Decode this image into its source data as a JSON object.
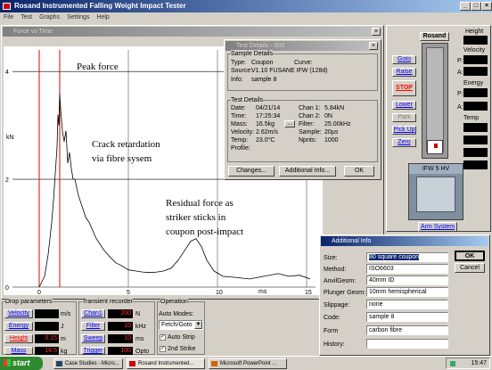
{
  "app": {
    "title": "Rosand Instrumented Falling Weight Impact Tester",
    "menus": [
      "File",
      "Test",
      "Graphs",
      "Settings",
      "Help"
    ]
  },
  "plot_window": {
    "title": "Force vs Time",
    "y_unit": "kN",
    "x_unit": "ms",
    "y_ticks": [
      "4",
      "2",
      "0"
    ],
    "x_ticks": [
      "0",
      "5",
      "10",
      "15"
    ],
    "annotations": {
      "peak": "Peak force",
      "crack_line1": "Crack retardation",
      "crack_line2": "via fibre sysem",
      "resid_line1": "Residual force as",
      "resid_line2": "striker sticks in",
      "resid_line3": "coupon post-impact"
    }
  },
  "chart_data": {
    "type": "line",
    "xlabel": "ms",
    "ylabel": "kN",
    "ylim": [
      0,
      4.4
    ],
    "xlim": [
      -1.5,
      15.5
    ],
    "x": [
      0,
      0.3,
      0.5,
      0.7,
      0.8,
      0.9,
      1.0,
      1.05,
      1.1,
      1.15,
      1.2,
      1.25,
      1.3,
      1.4,
      1.5,
      1.6,
      1.7,
      1.8,
      1.9,
      2.0,
      2.2,
      2.4,
      2.6,
      2.8,
      3.0,
      3.2,
      3.4,
      3.6,
      3.8,
      4.0,
      4.3,
      4.6,
      5.0,
      5.4,
      5.8,
      6.2,
      6.6,
      7.0,
      7.4,
      7.8,
      8.2,
      8.5,
      8.8,
      9.1,
      9.4,
      9.8,
      10.3,
      11.0,
      11.8,
      12.6,
      13.4,
      14.0,
      14.6,
      15.2
    ],
    "y": [
      0,
      0.2,
      0.6,
      1.2,
      1.6,
      2.1,
      2.6,
      3.2,
      3.0,
      3.6,
      3.3,
      3.1,
      2.9,
      2.7,
      2.9,
      2.3,
      2.5,
      2.2,
      2.0,
      2.0,
      1.7,
      1.5,
      1.3,
      1.2,
      1.05,
      0.9,
      0.8,
      0.7,
      0.62,
      0.55,
      0.45,
      0.4,
      0.32,
      0.3,
      0.28,
      0.27,
      0.28,
      0.3,
      0.35,
      0.5,
      0.7,
      0.85,
      0.9,
      0.75,
      0.5,
      0.3,
      0.2,
      0.18,
      0.15,
      0.2,
      0.25,
      0.2,
      0.22,
      0.15
    ]
  },
  "test_details": {
    "title": "Test Details - 003",
    "sample_header": "Sample Details",
    "type_label": "Type:",
    "type_value": "Coupon",
    "curve_label": "Curve:",
    "source_label": "Source:",
    "source_value": "V1.10 FUSANE IFW (128d)",
    "info_label": "Info:",
    "info_value": "sample 8",
    "test_header": "Test Details",
    "date_label": "Date:",
    "date_value": "04/21/14",
    "time_label": "Time:",
    "time_value": "17:25:34",
    "mass_label": "Mass:",
    "mass_value": "16.5kg",
    "velocity_label": "Velocity:",
    "velocity_value": "2.62m/s",
    "temp_label": "Temp:",
    "temp_value": "23.0°C",
    "profile_label": "Profile:",
    "chan1_label": "Chan 1:",
    "chan1_value": "5.84kN",
    "chan2_label": "Chan 2:",
    "chan2_value": "0N",
    "filter_label": "Filter:",
    "filter_value": "25.00kHz",
    "sample_label": "Sample:",
    "sample_value": "20µs",
    "npnts_label": "Npnts:",
    "npnts_value": "1000",
    "ellipsis": "...",
    "btn_changes": "Changes...",
    "btn_additional": "Additional Info...",
    "btn_ok": "OK"
  },
  "additional_info": {
    "title": "Additional Info",
    "size_label": "Size:",
    "size_value": "80 square coupon",
    "method_label": "Method:",
    "method_value": "ISO6603",
    "anvil_label": "AnvilGeom:",
    "anvil_value": "40mm ID",
    "plunger_label": "Plunger Geom:",
    "plunger_value": "10mm hemispherical",
    "slippage_label": "Slippage:",
    "slippage_value": "none",
    "code_label": "Code:",
    "code_value": "sample 8",
    "form_label": "Form",
    "form_value": "carbon fibre",
    "history_label": "History:",
    "history_value": "",
    "btn_ok": "OK",
    "btn_cancel": "Cancel"
  },
  "control": {
    "rosand": "Rosand",
    "goto": "Goto",
    "raise": "Raise",
    "stop": "STOP",
    "lower": "Lower",
    "park": "Park",
    "pick_up": "Pick Up",
    "zero": "Zero",
    "ifw": "IFW 5 HV",
    "arm_system": "Arm System",
    "stop_color": "#ff0000"
  },
  "readouts": {
    "height": "Height",
    "velocity": "Velocity",
    "p1": "P:",
    "a1": "A:",
    "energy": "Energy",
    "p2": "P:",
    "a2": "A:",
    "temp": "Temp"
  },
  "drop_params": {
    "header": "Drop parameters",
    "velocity_label": "Velocity",
    "velocity_unit": "m/s",
    "energy_label": "Energy",
    "energy_unit": "J",
    "height_label": "Height",
    "height_value": "0.15",
    "height_unit": "m",
    "mass_label": "Mass",
    "mass_value": "16.5",
    "mass_unit": "kg"
  },
  "transient": {
    "header": "Transient recorder",
    "chan1": "Chan1",
    "chan1_value": "200",
    "chan1_unit": "N",
    "filter": "Filter",
    "filter_value": "10",
    "filter_unit": "kHz",
    "sweep": "Sweep",
    "sweep_value": "10",
    "sweep_unit": "ms",
    "trigger": "Trigger",
    "trigger_value": "100",
    "trigger_unit": "Opto"
  },
  "operation": {
    "header": "Operation",
    "auto_modes": "Auto Modes:",
    "mode_value": "Fetch/Goto",
    "auto_strip": "Auto Strip",
    "second_strike": "2nd Strike"
  },
  "taskbar": {
    "start": "start",
    "tasks": [
      "Case Studies - Micro...",
      "Rosand Instrumented...",
      "Microsoft PowerPoint ..."
    ],
    "clock": "15:47"
  }
}
